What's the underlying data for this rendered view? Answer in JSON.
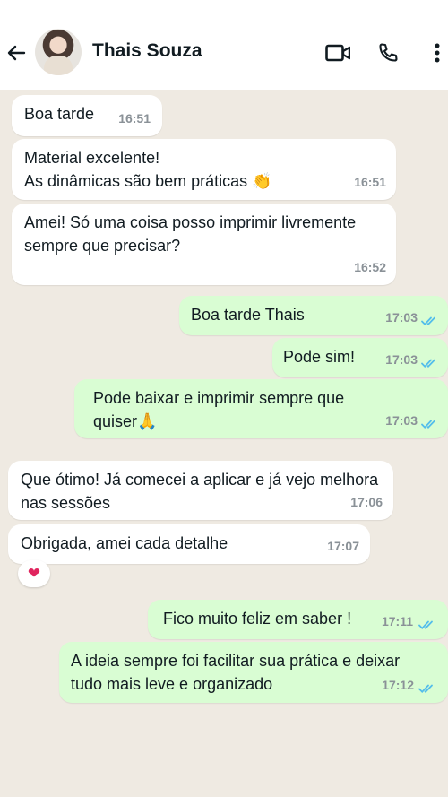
{
  "header": {
    "contact_name": "Thais Souza",
    "back_icon": "arrow-left-icon",
    "video_icon": "video-call-icon",
    "call_icon": "phone-icon",
    "menu_icon": "more-vertical-icon"
  },
  "messages": [
    {
      "direction": "in",
      "lines": [
        "Boa tarde"
      ],
      "time": "16:51"
    },
    {
      "direction": "in",
      "lines": [
        "Material excelente!",
        "As dinâmicas são bem práticas 👏"
      ],
      "time": "16:51"
    },
    {
      "direction": "in",
      "lines": [
        "Amei! Só uma coisa posso imprimir livremente",
        "sempre que precisar?"
      ],
      "time": "16:52"
    },
    {
      "direction": "out",
      "lines": [
        "Boa tarde Thais"
      ],
      "time": "17:03"
    },
    {
      "direction": "out",
      "lines": [
        "Pode sim!"
      ],
      "time": "17:03"
    },
    {
      "direction": "out",
      "lines": [
        "Pode baixar e imprimir sempre que",
        "quiser🙏"
      ],
      "time": "17:03"
    },
    {
      "direction": "in",
      "lines": [
        "Que ótimo! Já comecei a aplicar e já vejo melhora",
        "nas sessões"
      ],
      "time": "17:06"
    },
    {
      "direction": "in",
      "lines": [
        "Obrigada, amei cada detalhe"
      ],
      "time": "17:07",
      "reaction": "❤"
    },
    {
      "direction": "out",
      "lines": [
        "Fico muito feliz em saber !"
      ],
      "time": "17:11"
    },
    {
      "direction": "out",
      "lines": [
        "A ideia sempre foi facilitar sua prática e deixar",
        "tudo mais leve e organizado"
      ],
      "time": "17:12"
    }
  ],
  "colors": {
    "incoming_bubble": "#ffffff",
    "outgoing_bubble": "#d9fdd3",
    "chat_background": "#efeae2",
    "read_ticks": "#53bdeb"
  }
}
